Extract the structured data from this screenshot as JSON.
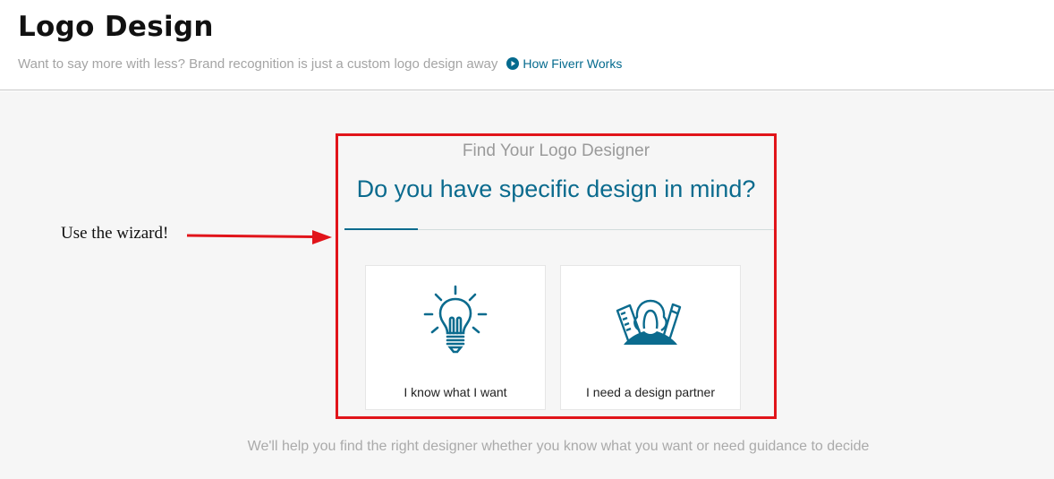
{
  "header": {
    "title": "Logo Design",
    "subtitle": "Want to say more with less? Brand recognition is just a custom logo design away",
    "how_link": {
      "label": "How Fiverr Works",
      "icon": "play-circle-icon"
    }
  },
  "annotation": {
    "text": "Use the wizard!",
    "arrow_color": "#e1141a"
  },
  "wizard": {
    "kicker": "Find Your Logo Designer",
    "question": "Do you have specific design in mind?",
    "progress": 0.17,
    "options": [
      {
        "label": "I know what I want",
        "icon": "lightbulb-icon"
      },
      {
        "label": "I need a design partner",
        "icon": "designer-partner-icon"
      }
    ],
    "border_color": "#e1141a",
    "accent_color": "#0b6b8e"
  },
  "footer": {
    "note": "We'll help you find the right designer whether you know what you want or need guidance to decide"
  }
}
